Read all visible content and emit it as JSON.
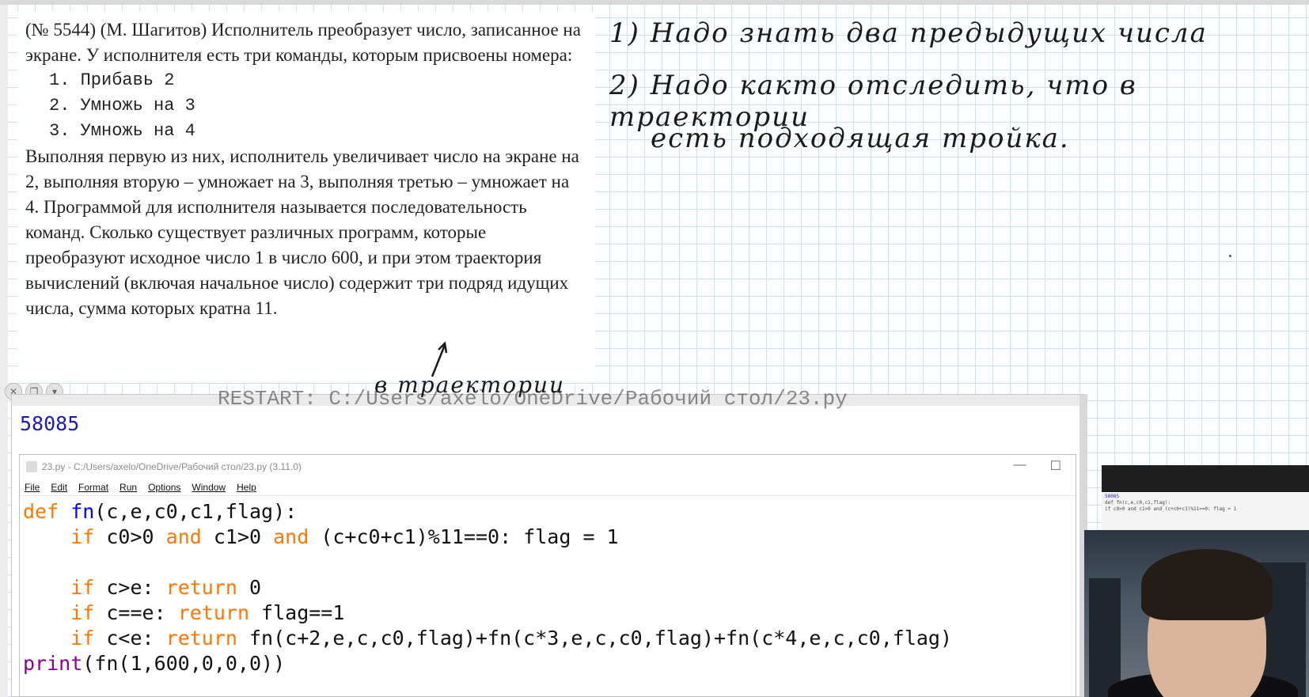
{
  "problem": {
    "intro": "(№ 5544) (М. Шагитов) Исполнитель преобразует число, записанное на экране. У исполнителя есть три команды, которым присвоены номера:",
    "commands": [
      "1. Прибавь 2",
      "2. Умножь на 3",
      "3. Умножь на 4"
    ],
    "body": "Выполняя первую из них, исполнитель увеличивает число на экране на 2, выполняя вторую – умножает на 3, выполняя третью – умножает на 4. Программой для исполнителя называется последовательность команд. Сколько существует различных программ, которые преобразуют исходное число 1 в число 600, и при этом траектория вычислений (включая начальное число) содержит три подряд идущих числа, сумма которых кратна 11."
  },
  "handwriting": {
    "line1": "1) Надо знать два предыдущих числа",
    "line2": "2) Надо както отследить, что в траектории",
    "line3": "есть подходящая тройка.",
    "note": "в траектории"
  },
  "shell": {
    "ghost_text": "RESTART: C:/Users/axelo/OneDrive/Рабочий стол/23.py",
    "output": "58085"
  },
  "editor": {
    "title": "23.py - C:/Users/axelo/OneDrive/Рабочий стол/23.py (3.11.0)",
    "menu": [
      "File",
      "Edit",
      "Format",
      "Run",
      "Options",
      "Window",
      "Help"
    ],
    "code": {
      "l1_def": "def",
      "l1_fn": "fn",
      "l1_rest": "(c,e,c0,c1,flag):",
      "l2_if": "if",
      "l2_a": " c0>0 ",
      "l2_and1": "and",
      "l2_b": " c1>0 ",
      "l2_and2": "and",
      "l2_c": " (c+c0+c1)%11==0: flag = 1",
      "l4_if": "if",
      "l4_a": " c>e: ",
      "l4_ret": "return",
      "l4_b": " 0",
      "l5_if": "if",
      "l5_a": " c==e: ",
      "l5_ret": "return",
      "l5_b": " flag==1",
      "l6_if": "if",
      "l6_a": " c<e: ",
      "l6_ret": "return",
      "l6_b": " fn(c+2,e,c,c0,flag)+fn(c*3,e,c,c0,flag)+fn(c*4,e,c,c0,flag)",
      "l7_print": "print",
      "l7_rest": "(fn(1,600,0,0,0))"
    }
  },
  "thumbnail": {
    "output": "58085",
    "line1": "def fn(c,e,c0,c1,flag):",
    "line2": "if c0>0 and c1>0 and (c+c0+c1)%11==0: flag = 1"
  },
  "colors": {
    "keyword": "#ff7700",
    "defname": "#0000ff",
    "builtin": "#900090",
    "shell_output": "#1a1ab8",
    "grid": "#cfe0f1"
  },
  "icons": {
    "editor_file": "python-file-icon",
    "minimize": "minimize-icon",
    "maximize": "maximize-icon"
  }
}
